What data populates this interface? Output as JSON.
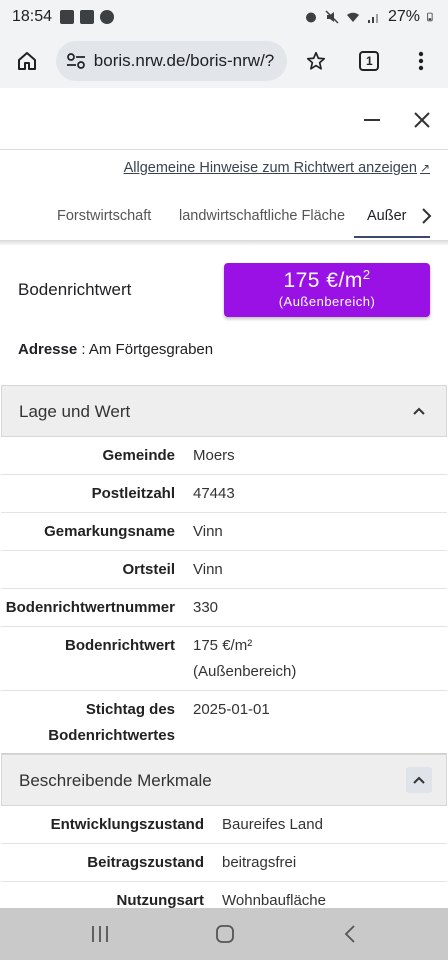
{
  "status_bar": {
    "time": "18:54",
    "battery": "27%"
  },
  "browser": {
    "url": "boris.nrw.de/boris-nrw/?",
    "tab_count": "1"
  },
  "hint_link": {
    "label": "Allgemeine Hinweise zum Richtwert anzeigen",
    "ext_icon": "↗"
  },
  "tabs": [
    {
      "label": "Forstwirtschaft"
    },
    {
      "label": "landwirtschaftliche Fläche"
    },
    {
      "label": "Außer"
    }
  ],
  "bodenrichtwert": {
    "label": "Bodenrichtwert",
    "value_main": "175 €/m",
    "value_exp": "2",
    "value_sub": "(Außenbereich)"
  },
  "address": {
    "label": "Adresse",
    "separator": " : ",
    "value": "Am Förtgesgraben"
  },
  "lage_panel": {
    "title": "Lage und Wert",
    "rows": [
      {
        "key": "Gemeinde",
        "value": "Moers"
      },
      {
        "key": "Postleitzahl",
        "value": "47443"
      },
      {
        "key": "Gemarkungsname",
        "value": "Vinn"
      },
      {
        "key": "Ortsteil",
        "value": "Vinn"
      },
      {
        "key": "Bodenrichtwertnummer",
        "value": "330"
      },
      {
        "key": "Bodenrichtwert",
        "value": "175 €/m²",
        "value2": "(Außenbereich)"
      },
      {
        "key": "Stichtag des",
        "key2": "Bodenrichtwertes",
        "value": "2025-01-01"
      }
    ]
  },
  "merkmale_panel": {
    "title": "Beschreibende Merkmale",
    "rows": [
      {
        "key": "Entwicklungszustand",
        "value": "Baureifes Land"
      },
      {
        "key": "Beitragszustand",
        "value": "beitragsfrei"
      },
      {
        "key": "Nutzungsart",
        "value": "Wohnbaufläche"
      }
    ]
  },
  "colors": {
    "badge": "#9a11e6",
    "panel_header": "#eeeeee",
    "nav_bar": "#c9c9c9"
  }
}
